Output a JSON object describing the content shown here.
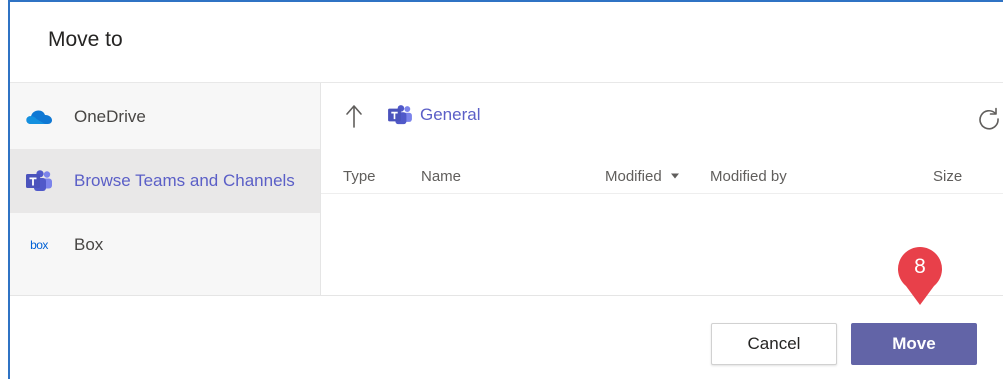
{
  "dialog": {
    "title": "Move to"
  },
  "sidebar": {
    "items": [
      {
        "label": "OneDrive",
        "icon": "onedrive-icon",
        "selected": false
      },
      {
        "label": "Browse Teams and Channels",
        "icon": "teams-icon",
        "selected": true
      },
      {
        "label": "Box",
        "icon": "box-icon",
        "icon_text": "box",
        "selected": false
      }
    ]
  },
  "location": {
    "up_icon": "arrow-up-icon",
    "crumb_icon": "teams-icon",
    "current": "General",
    "refresh_icon": "refresh-icon"
  },
  "columns": {
    "type": "Type",
    "name": "Name",
    "modified": "Modified",
    "modified_by": "Modified by",
    "size": "Size"
  },
  "buttons": {
    "cancel": "Cancel",
    "move": "Move"
  },
  "annotation": {
    "step": "8"
  },
  "colors": {
    "teams_purple": "#5b5fc7",
    "move_button": "#6264a7",
    "badge_red": "#e8404a",
    "onedrive_blue": "#0f78d4",
    "frame_blue": "#2f73c4"
  }
}
